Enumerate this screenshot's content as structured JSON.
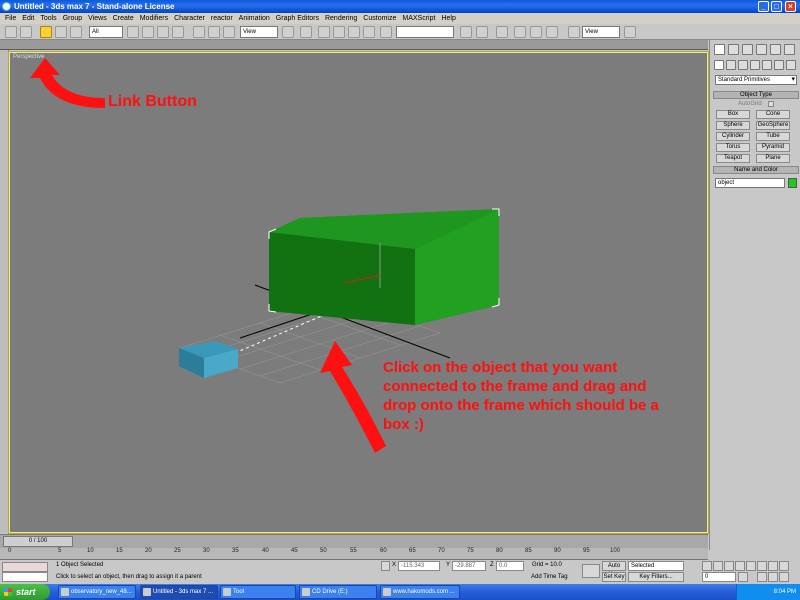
{
  "window": {
    "title": "Untitled - 3ds max 7 - Stand-alone License"
  },
  "menu": [
    "File",
    "Edit",
    "Tools",
    "Group",
    "Views",
    "Create",
    "Modifiers",
    "Character",
    "reactor",
    "Animation",
    "Graph Editors",
    "Rendering",
    "Customize",
    "MAXScript",
    "Help"
  ],
  "toolbar": {
    "selection_filter": "All",
    "coord_system": "View",
    "view_dropdown": "View"
  },
  "viewport": {
    "label": "Perspective"
  },
  "command_panel": {
    "category": "Standard Primitives",
    "object_type_header": "Object Type",
    "autogrid_label": "AutoGrid",
    "buttons": [
      "Box",
      "Cone",
      "Sphere",
      "GeoSphere",
      "Cylinder",
      "Tube",
      "Torus",
      "Pyramid",
      "Teapot",
      "Plane"
    ],
    "name_color_header": "Name and Color",
    "name_value": "object",
    "object_color": "#1ec81e"
  },
  "timeline": {
    "slider_label": "0 / 100",
    "ticks": [
      "0",
      "5",
      "10",
      "15",
      "20",
      "25",
      "30",
      "35",
      "40",
      "45",
      "50",
      "55",
      "60",
      "65",
      "70",
      "75",
      "80",
      "85",
      "90",
      "95",
      "100"
    ]
  },
  "status": {
    "selection": "1 Object Selected",
    "prompt": "Click to select an object, then drag to assign it a parent",
    "x_value": "-115.343",
    "y_value": "-29.887",
    "z_value": "0.0",
    "x_label": "X",
    "y_label": "Y",
    "z_label": "Z",
    "grid": "Grid = 10.0",
    "add_time_tag": "Add Time Tag",
    "auto_key": "Auto Key",
    "set_key": "Set Key",
    "key_mode": "Selected",
    "key_filters": "Key Filters...",
    "frame": "0"
  },
  "taskbar": {
    "start": "start",
    "tasks": [
      "observatory_new_48...",
      "Untitled - 3ds max 7 ...",
      "Tool",
      "CD Drive (E:)",
      "www.hakomods.com ..."
    ],
    "clock": "8:04 PM"
  },
  "annotations": {
    "link": "Link Button",
    "instruction": "Click on the object that you want connected to the frame and drag and drop onto the frame which should be a box :)"
  },
  "colors": {
    "annotation": "#ff1010",
    "viewport_bg": "#7c7c7c",
    "big_box": "#1a8c1a",
    "small_box": "#3a98b8"
  }
}
